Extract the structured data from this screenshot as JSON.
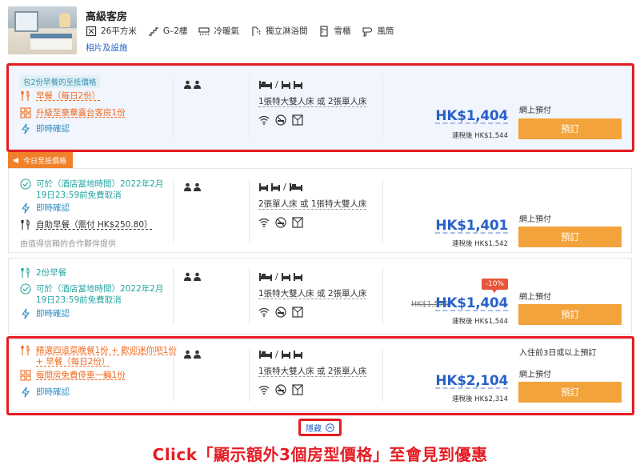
{
  "room": {
    "title": "高級客房",
    "amenities": [
      {
        "icon": "area-icon",
        "label": "26平方米"
      },
      {
        "icon": "stairs-icon",
        "label": "G–2樓"
      },
      {
        "icon": "aircon-icon",
        "label": "冷暖氣"
      },
      {
        "icon": "shower-icon",
        "label": "獨立淋浴間"
      },
      {
        "icon": "fridge-icon",
        "label": "雪櫃"
      },
      {
        "icon": "hairdryer-icon",
        "label": "風筒"
      }
    ],
    "link": "相片及設施"
  },
  "offers": [
    {
      "tag": "包2份早餐的至抵價格",
      "perks": [
        "早餐（每日2份）",
        "升級至豪華露台客房1份",
        "即時確認"
      ],
      "bed_text": "1張特大雙人床 或 2張單人床",
      "price": "HK$1,404",
      "tax_note": "連稅後 HK$1,544",
      "payment": "網上預付",
      "book_label": "預訂"
    },
    {
      "ribbon": "今日至抵價格",
      "perks": [
        "可於（酒店當地時間）2022年2月19日23:59前免費取消",
        "即時確認",
        "自助早餐（需付 HK$250.80）"
      ],
      "partner_note": "由值得信賴的合作夥伴提供",
      "bed_text": "2張單人床 或 1張特大雙人床",
      "price": "HK$1,401",
      "tax_note": "連稅後 HK$1,542",
      "payment": "網上預付",
      "book_label": "預訂"
    },
    {
      "perks": [
        "2份早餐",
        "可於（酒店當地時間）2022年2月19日23:59前免費取消",
        "即時確認"
      ],
      "bed_text": "1張特大雙人床 或 2張單人床",
      "discount": "-10%",
      "old_price": "HK$1,576",
      "price": "HK$1,404",
      "tax_note": "連稅後 HK$1,544",
      "payment": "網上預付",
      "book_label": "預訂"
    },
    {
      "perks": [
        "精選四道菜晚餐1份 + 歡迎迷你吧1份 + 早餐（每日2份）",
        "每間房免費停車一輛1份",
        "即時確認"
      ],
      "bed_text": "1張特大雙人床 或 2張單人床",
      "advance_note": "入住前3日或以上預訂",
      "price": "HK$2,104",
      "tax_note": "連稅後 HK$2,314",
      "payment": "網上預付",
      "book_label": "預訂"
    }
  ],
  "collapse_label": "隱藏",
  "caption": "Click「顯示額外3個房型價格」至會見到優惠",
  "colors": {
    "accent_blue": "#2962c8",
    "book_orange": "#f3a33b",
    "highlight_red": "#e51c23",
    "perk_orange": "#f06a1f"
  }
}
